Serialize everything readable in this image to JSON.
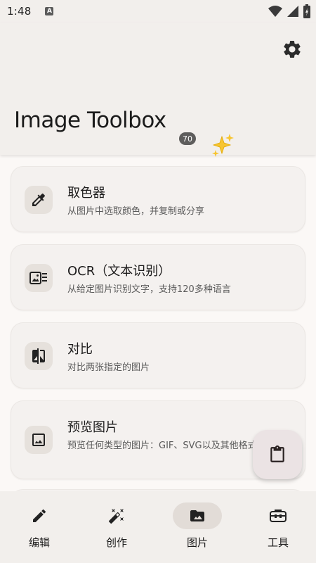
{
  "status_bar": {
    "time": "1:48",
    "notification_icon": "A"
  },
  "header": {
    "title": "Image Toolbox",
    "version_badge": "70",
    "sparkle_icon": "sparkles-icon",
    "settings_icon": "gear-icon"
  },
  "tools": [
    {
      "title": "取色器",
      "description": "从图片中选取颜色，并复制或分享",
      "icon": "eyedropper-icon"
    },
    {
      "title": "OCR（文本识别）",
      "description": "从给定图片识别文字，支持120多种语言",
      "icon": "ocr-icon"
    },
    {
      "title": "对比",
      "description": "对比两张指定的图片",
      "icon": "compare-icon"
    },
    {
      "title": "预览图片",
      "description": "预览任何类型的图片：GIF、SVG以及其他格式",
      "icon": "image-preview-icon"
    }
  ],
  "fab": {
    "icon": "clipboard-icon"
  },
  "bottom_nav": {
    "items": [
      {
        "label": "编辑",
        "icon": "pencil-icon",
        "active": false
      },
      {
        "label": "创作",
        "icon": "magic-wand-icon",
        "active": false
      },
      {
        "label": "图片",
        "icon": "folder-image-icon",
        "active": true
      },
      {
        "label": "工具",
        "icon": "toolbox-icon",
        "active": false
      }
    ]
  },
  "colors": {
    "background": "#fbf8f6",
    "surface": "#f2efec",
    "card": "#f4f1ef",
    "icon_container": "#e6e1dc",
    "active_nav": "#e2dcd7",
    "fab": "#ebe3e4"
  }
}
